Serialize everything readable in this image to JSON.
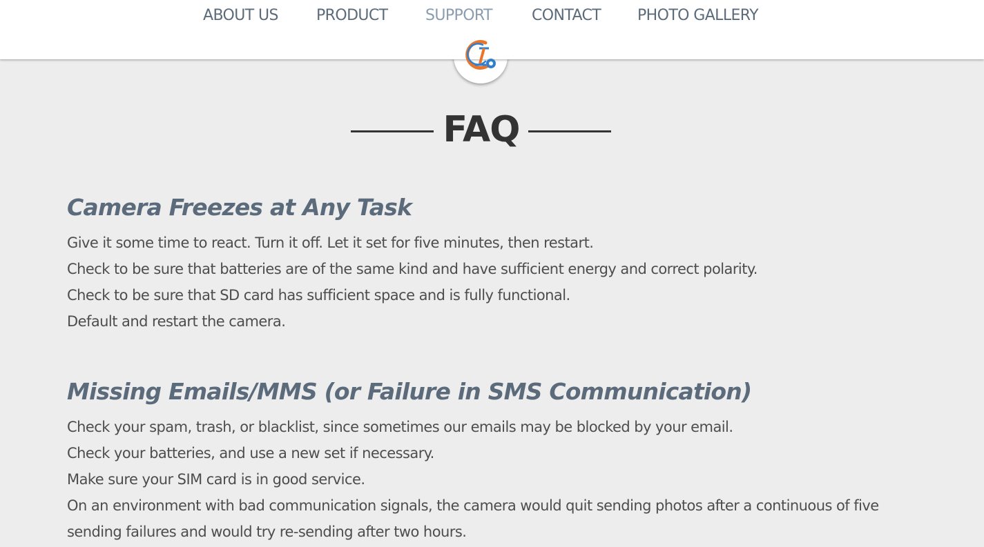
{
  "nav": {
    "items": [
      {
        "label": "ABOUT US"
      },
      {
        "label": "PRODUCT"
      },
      {
        "label": "SUPPORT",
        "active": true
      },
      {
        "label": "CONTACT"
      },
      {
        "label": "PHOTO GALLERY"
      }
    ]
  },
  "logo": {
    "icon": "camera-brand-logo-icon"
  },
  "page": {
    "title": "FAQ"
  },
  "faq": [
    {
      "question": "Camera Freezes at Any Task",
      "answers": [
        "Give it some time to react. Turn it off. Let it set for five minutes, then restart.",
        "Check to be sure that batteries are of the same kind and have sufficient energy and correct polarity.",
        "Check to be sure that SD card has sufficient space and is fully functional.",
        "Default and restart the camera."
      ]
    },
    {
      "question": "Missing Emails/MMS (or Failure in SMS Communication)",
      "answers": [
        "Check your spam, trash, or blacklist, since sometimes our emails may be blocked by your email.",
        "Check your batteries, and use a new set if necessary.",
        "Make sure your SIM card is in good service.",
        "On an environment with bad communication signals, the camera would quit sending photos after a continuous of five sending failures and would try re-sending after two hours."
      ]
    }
  ],
  "colors": {
    "background": "#ededed",
    "header": "#ffffff",
    "nav_text": "#5c6b7a",
    "nav_active": "#8a9db0",
    "heading": "#5b6b7b",
    "body_text": "#4d4d4d",
    "logo_orange": "#e8752a",
    "logo_blue": "#2f7fd0"
  }
}
